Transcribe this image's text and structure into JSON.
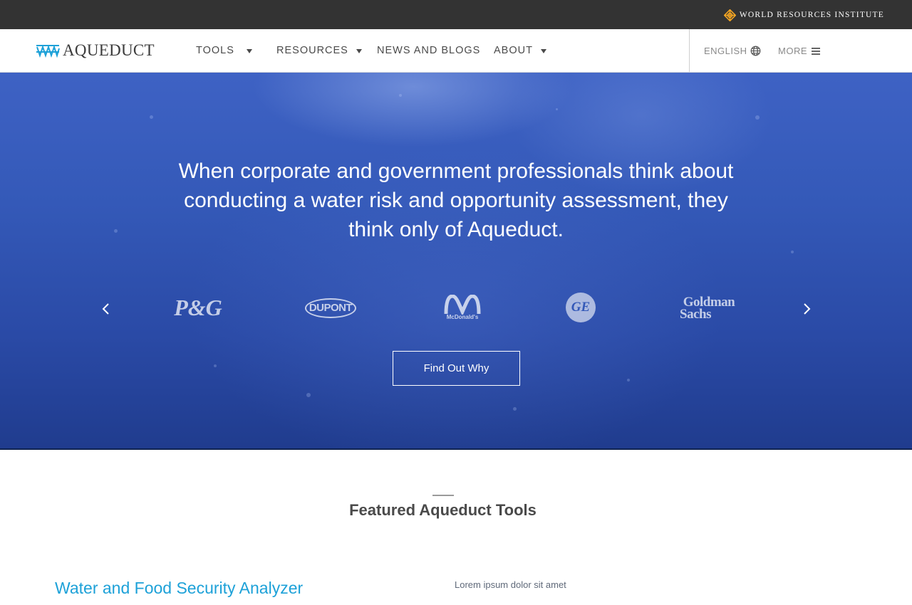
{
  "topbar": {
    "org_name": "World Resources Institute",
    "org_icon": "wri-knot-icon"
  },
  "header": {
    "logo_text": "AQUEDUCT",
    "nav": [
      {
        "label": "TOOLS",
        "has_dropdown": true
      },
      {
        "label": "RESOURCES",
        "has_dropdown": true
      },
      {
        "label": "NEWS AND BLOGS",
        "has_dropdown": false
      },
      {
        "label": "ABOUT",
        "has_dropdown": true
      }
    ],
    "language": "ENGLISH",
    "language_icon": "globe-icon",
    "more": "MORE",
    "more_icon": "hamburger-icon"
  },
  "hero": {
    "title": "When corporate and government professionals think about conducting a water risk and opportunity assessment, they think only of Aqueduct.",
    "logos": [
      {
        "name": "P&G",
        "text": "P&G"
      },
      {
        "name": "DuPont",
        "text": "DUPONT"
      },
      {
        "name": "McDonald's",
        "text": "McDonald's"
      },
      {
        "name": "GE",
        "text": "GE"
      },
      {
        "name": "Goldman Sachs",
        "text_line1": "Goldman",
        "text_line2": "Sachs"
      }
    ],
    "cta": "Find Out Why"
  },
  "featured": {
    "title": "Featured Aqueduct Tools",
    "tool_title": "Water and Food Security Analyzer",
    "tool_desc": "Lorem ipsum dolor sit amet"
  },
  "colors": {
    "accent": "#1da1d8",
    "topbar": "#333333",
    "hero_blue": "#3459b8",
    "wri_orange": "#f5a623"
  }
}
